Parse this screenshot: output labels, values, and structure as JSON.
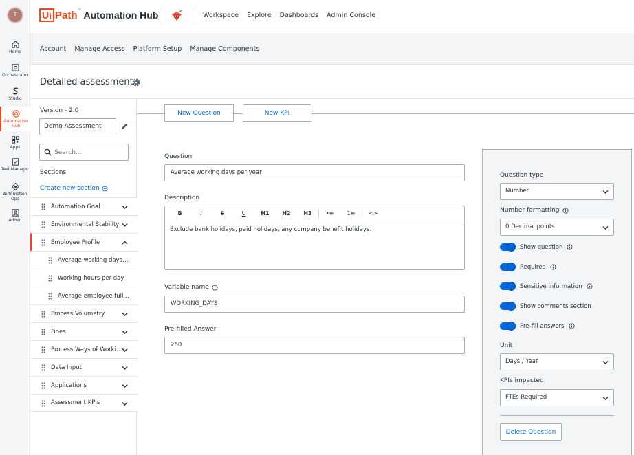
{
  "user": {
    "initial": "T"
  },
  "rail": [
    {
      "label": "Home",
      "icon": "home-icon"
    },
    {
      "label": "Orchestrator",
      "icon": "orchestrator-icon"
    },
    {
      "label": "Studio",
      "icon": "studio-icon"
    },
    {
      "label": "Automation Hub",
      "icon": "automation-hub-icon",
      "active": true
    },
    {
      "label": "Apps",
      "icon": "apps-icon"
    },
    {
      "label": "Test Manager",
      "icon": "test-manager-icon"
    },
    {
      "label": "Automation Ops",
      "icon": "automation-ops-icon"
    },
    {
      "label": "Admin",
      "icon": "admin-icon"
    }
  ],
  "header": {
    "logo_ui": "Ui",
    "logo_path": "Path",
    "logo_tm": "™",
    "product": "Automation Hub",
    "nav": [
      "Workspace",
      "Explore",
      "Dashboards",
      "Admin Console"
    ]
  },
  "subnav": [
    "Account",
    "Manage Access",
    "Platform Setup",
    "Manage Components"
  ],
  "page": {
    "title": "Detailed assessment"
  },
  "sidebar": {
    "version_label": "Version - 2.0",
    "version_name": "Demo Assessment",
    "search_placeholder": "Search...",
    "sections_label": "Sections",
    "create_section": "Create new section",
    "sections": [
      {
        "label": "Automation Goal",
        "child": false
      },
      {
        "label": "Environmental Stability",
        "child": false
      },
      {
        "label": "Employee Profile",
        "child": false,
        "active": true,
        "expanded": true
      },
      {
        "label": "Average working days per year",
        "child": true
      },
      {
        "label": "Working hours per day",
        "child": true
      },
      {
        "label": "Average employee full cost per year",
        "child": true
      },
      {
        "label": "Process Volumetry",
        "child": false
      },
      {
        "label": "Fines",
        "child": false
      },
      {
        "label": "Process Ways of Working",
        "child": false
      },
      {
        "label": "Data Input",
        "child": false
      },
      {
        "label": "Applications",
        "child": false
      },
      {
        "label": "Assessment KPIs",
        "child": false
      }
    ]
  },
  "tabs": {
    "new_question": "New Question",
    "new_kpi": "New KPI"
  },
  "form": {
    "question_label": "Question",
    "question_value": "Average working days per year",
    "description_label": "Description",
    "toolbar": [
      "B",
      "I",
      "S",
      "U",
      "H1",
      "H2",
      "H3",
      "•≡",
      "1≡",
      "<>"
    ],
    "description_value": "Exclude bank holidays, paid holidays, any company benefit holidays.",
    "variable_label": "Variable name",
    "variable_value": "WORKING_DAYS",
    "prefilled_label": "Pre-filled Answer",
    "prefilled_value": "260"
  },
  "panel": {
    "question_type_label": "Question type",
    "question_type_value": "Number",
    "number_formatting_label": "Number formatting",
    "number_formatting_value": "0 Decimal points",
    "toggles": [
      {
        "label": "Show question",
        "info": true,
        "on": true
      },
      {
        "label": "Required",
        "info": true,
        "on": true
      },
      {
        "label": "Sensitive information",
        "info": true,
        "on": true
      },
      {
        "label": "Show comments section",
        "info": false,
        "on": true
      },
      {
        "label": "Pre-fill answers",
        "info": true,
        "on": true
      }
    ],
    "unit_label": "Unit",
    "unit_value": "Days / Year",
    "kpis_label": "KPIs impacted",
    "kpis_value": "FTEs Required",
    "delete_label": "Delete Question"
  },
  "colors": {
    "accent": "#fa4616",
    "link": "#0067df",
    "border": "#a4b1b8"
  }
}
